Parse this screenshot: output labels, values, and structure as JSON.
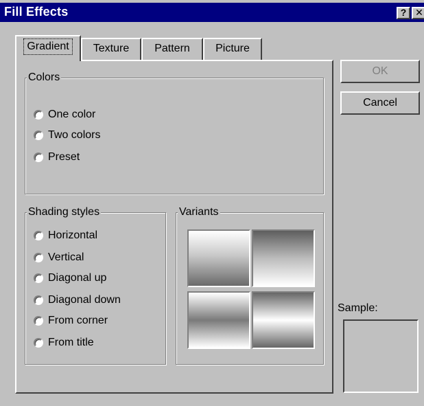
{
  "window": {
    "title": "Fill Effects",
    "help_button": "?",
    "close_button": "✕"
  },
  "tabs": [
    {
      "label": "Gradient",
      "active": true
    },
    {
      "label": "Texture",
      "active": false
    },
    {
      "label": "Pattern",
      "active": false
    },
    {
      "label": "Picture",
      "active": false
    }
  ],
  "colors_group": {
    "legend": "Colors",
    "options": [
      {
        "label": "One color",
        "selected": false
      },
      {
        "label": "Two colors",
        "selected": false
      },
      {
        "label": "Preset",
        "selected": false
      }
    ]
  },
  "shading_group": {
    "legend": "Shading styles",
    "options": [
      {
        "label": "Horizontal",
        "selected": false
      },
      {
        "label": "Vertical",
        "selected": false
      },
      {
        "label": "Diagonal up",
        "selected": false
      },
      {
        "label": "Diagonal down",
        "selected": false
      },
      {
        "label": "From corner",
        "selected": false
      },
      {
        "label": "From title",
        "selected": false
      }
    ]
  },
  "variants_group": {
    "legend": "Variants"
  },
  "buttons": {
    "ok": "OK",
    "cancel": "Cancel"
  },
  "sample": {
    "label": "Sample:"
  },
  "colors": {
    "titlebar": "#000080",
    "face": "#c0c0c0",
    "disabled_text": "#808080"
  }
}
